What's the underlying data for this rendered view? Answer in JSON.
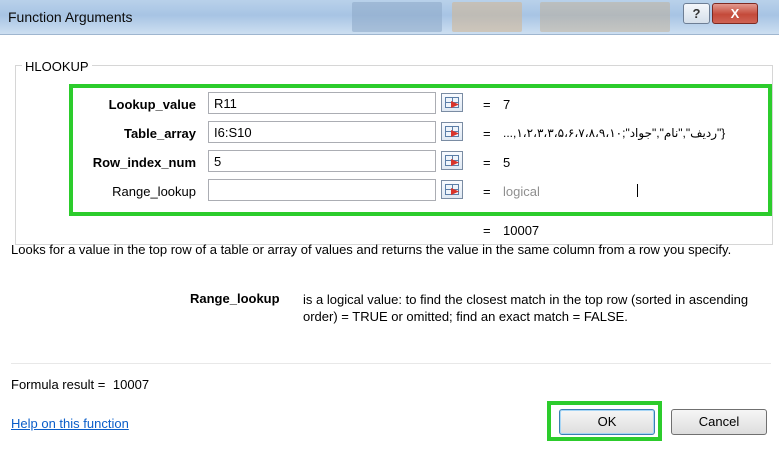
{
  "window": {
    "title": "Function Arguments",
    "help_glyph": "?",
    "close_glyph": "X",
    "background_color": "#ffffff",
    "title_bar_color": "#b9d1ea",
    "highlight_color": "#2ccc2c"
  },
  "function_name": "HLOOKUP",
  "arguments": [
    {
      "label": "Lookup_value",
      "bold": true,
      "input": "R11",
      "equals": "=",
      "result": "7",
      "icon": "collapse-dialog-icon"
    },
    {
      "label": "Table_array",
      "bold": true,
      "input": "I6:S10",
      "equals": "=",
      "result": "{\"ردیف\",\"نام\",\"جواد\";١،٢،٣،٣،۵،۶،٧،٨،٩،١٠,...",
      "icon": "collapse-dialog-icon"
    },
    {
      "label": "Row_index_num",
      "bold": true,
      "input": "5",
      "equals": "=",
      "result": "5",
      "icon": "collapse-dialog-icon"
    },
    {
      "label": "Range_lookup",
      "bold": false,
      "input": "",
      "equals": "=",
      "result": "logical",
      "icon": "collapse-dialog-icon"
    }
  ],
  "function_result": {
    "equals": "=",
    "value": "10007"
  },
  "description": "Looks for a value in the top row of a table or array of values and returns the value in the same column from a row you specify.",
  "parameter_help": {
    "name": "Range_lookup",
    "text": "is a logical value: to find the closest match in the top row (sorted in ascending order) = TRUE or omitted; find an exact match = FALSE."
  },
  "formula_result": {
    "label": "Formula result =",
    "value": "10007"
  },
  "help_link": "Help on this function",
  "buttons": {
    "ok": "OK",
    "cancel": "Cancel"
  }
}
